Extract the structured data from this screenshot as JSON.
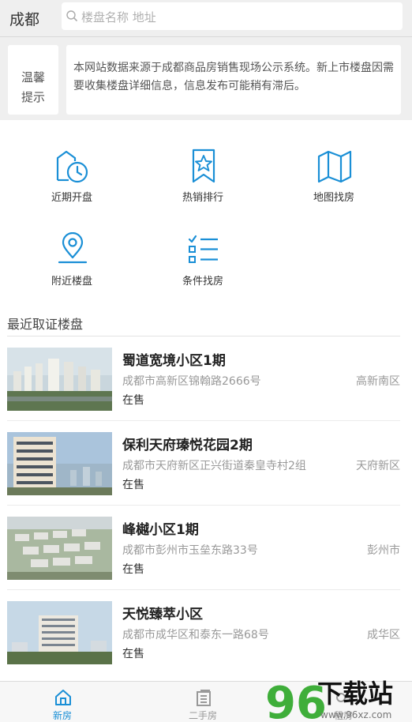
{
  "header": {
    "city": "成都",
    "search_placeholder": "楼盘名称 地址"
  },
  "notice": {
    "label_line1": "温馨",
    "label_line2": "提示",
    "text": "本网站数据来源于成都商品房销售现场公示系统。新上市楼盘因需要收集楼盘详细信息，信息发布可能稍有滞后。"
  },
  "menu": [
    {
      "label": "近期开盘",
      "icon": "house-clock-icon"
    },
    {
      "label": "热销排行",
      "icon": "star-bookmark-icon"
    },
    {
      "label": "地图找房",
      "icon": "map-icon"
    },
    {
      "label": "附近楼盘",
      "icon": "location-pin-icon"
    },
    {
      "label": "条件找房",
      "icon": "checklist-icon"
    }
  ],
  "section_title": "最近取证楼盘",
  "listings": [
    {
      "name": "蜀道宽境小区1期",
      "address": "成都市高新区锦翰路2666号",
      "district": "高新南区",
      "status": "在售"
    },
    {
      "name": "保利天府瑧悦花园2期",
      "address": "成都市天府新区正兴街道秦皇寺村2组",
      "district": "天府新区",
      "status": "在售"
    },
    {
      "name": "峰樾小区1期",
      "address": "成都市彭州市玉垒东路33号",
      "district": "彭州市",
      "status": "在售"
    },
    {
      "name": "天悦臻萃小区",
      "address": "成都市成华区和泰东一路68号",
      "district": "成华区",
      "status": "在售"
    }
  ],
  "tabs": [
    {
      "label": "新房",
      "icon": "home-icon",
      "active": true
    },
    {
      "label": "二手房",
      "icon": "building-icon",
      "active": false
    },
    {
      "label": "租房",
      "icon": "key-icon",
      "active": false
    }
  ],
  "watermark": {
    "logo_number": "96",
    "logo_text": "下载站",
    "url": "www.96xz.com"
  },
  "colors": {
    "accent": "#1a8fd6",
    "background_gray": "#efefef"
  }
}
